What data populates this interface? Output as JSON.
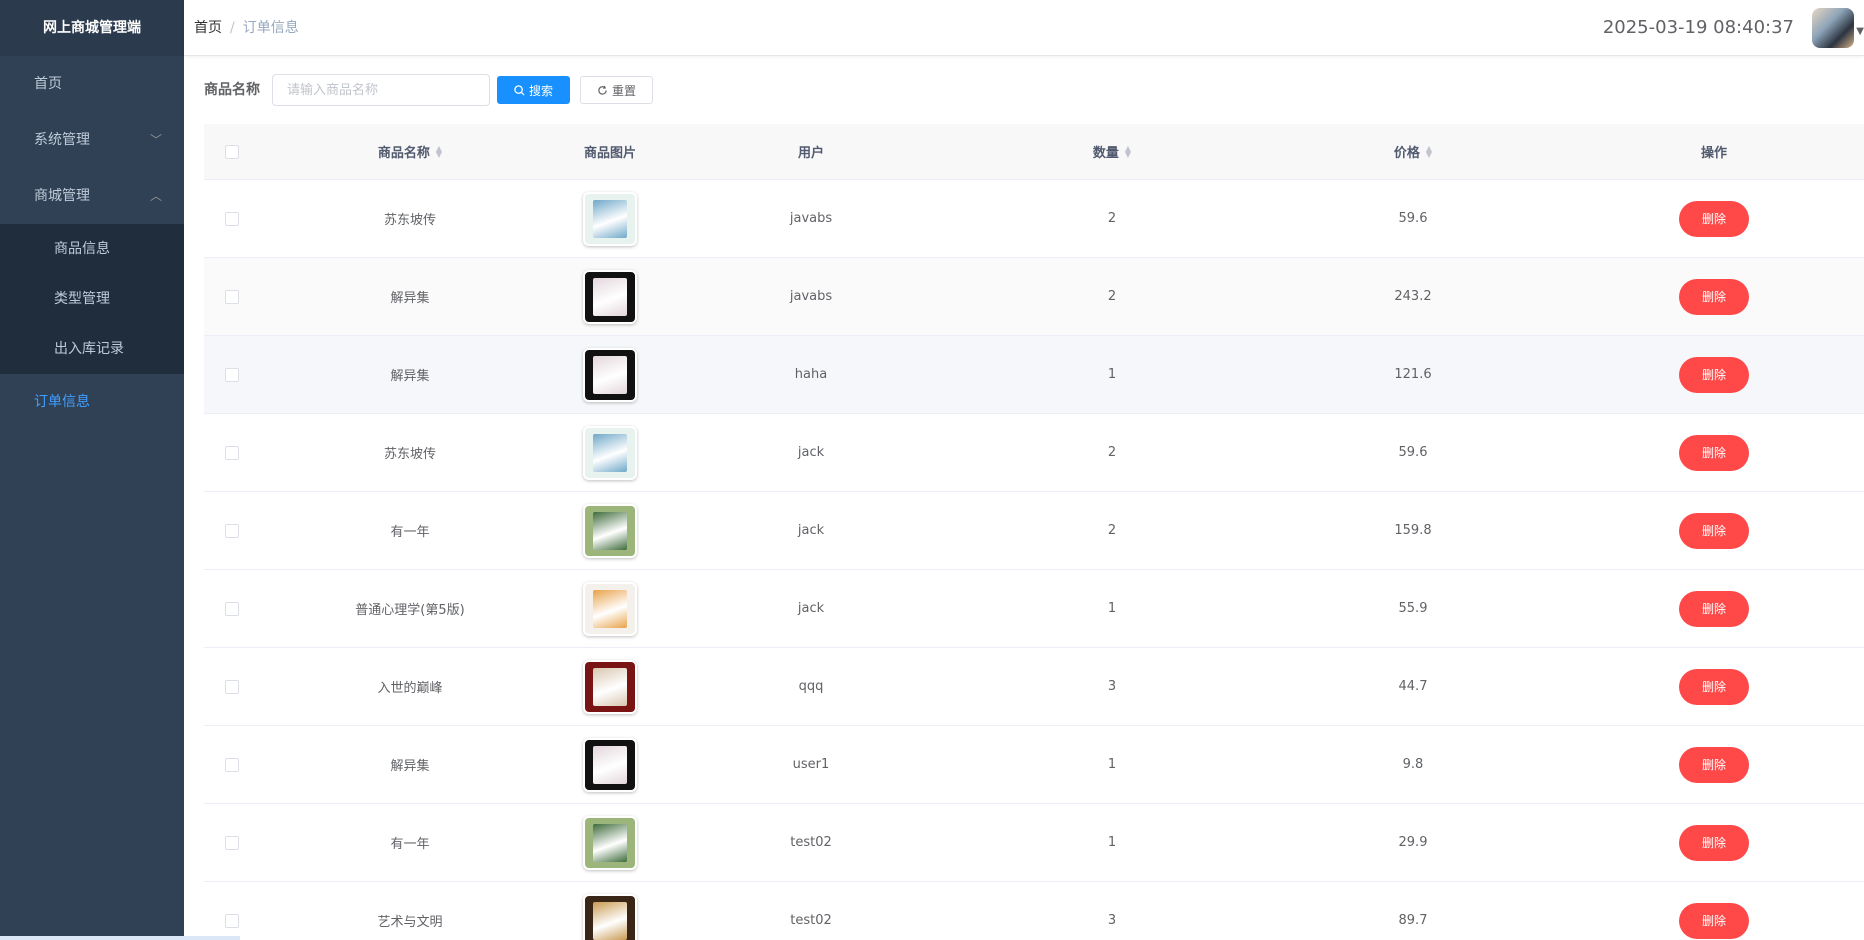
{
  "sidebar": {
    "logo": "网上商城管理端",
    "items": [
      {
        "label": "首页"
      },
      {
        "label": "系统管理",
        "arrow": "﹀"
      },
      {
        "label": "商城管理",
        "arrow": "︿"
      }
    ],
    "submenu": [
      {
        "label": "商品信息"
      },
      {
        "label": "类型管理"
      },
      {
        "label": "出入库记录"
      }
    ],
    "active": {
      "label": "订单信息"
    }
  },
  "header": {
    "breadcrumb_home": "首页",
    "breadcrumb_sep": "/",
    "breadcrumb_current": "订单信息",
    "datetime": "2025-03-19 08:40:37"
  },
  "search": {
    "label": "商品名称",
    "placeholder": "请输入商品名称",
    "search_button": "搜索",
    "reset_button": "重置"
  },
  "table": {
    "columns": [
      "商品名称",
      "商品图片",
      "用户",
      "数量",
      "价格",
      "操作"
    ],
    "delete_label": "删除",
    "rows": [
      {
        "name": "苏东坡传",
        "user": "javabs",
        "qty": "2",
        "price": "59.6",
        "cover": [
          "#e8f2ee",
          "#6fa8c9"
        ]
      },
      {
        "name": "解异集",
        "user": "javabs",
        "qty": "2",
        "price": "243.2",
        "cover": [
          "#111111",
          "#e3d6dc"
        ]
      },
      {
        "name": "解异集",
        "user": "haha",
        "qty": "1",
        "price": "121.6",
        "cover": [
          "#111111",
          "#e3d6dc"
        ]
      },
      {
        "name": "苏东坡传",
        "user": "jack",
        "qty": "2",
        "price": "59.6",
        "cover": [
          "#e8f2ee",
          "#6fa8c9"
        ]
      },
      {
        "name": "有一年",
        "user": "jack",
        "qty": "2",
        "price": "159.8",
        "cover": [
          "#9bb57a",
          "#3d6b3a"
        ]
      },
      {
        "name": "普通心理学(第5版)",
        "user": "jack",
        "qty": "1",
        "price": "55.9",
        "cover": [
          "#f4f1ec",
          "#e8a24a"
        ]
      },
      {
        "name": "入世的巅峰",
        "user": "qqq",
        "qty": "3",
        "price": "44.7",
        "cover": [
          "#7a1414",
          "#d8c7b0"
        ]
      },
      {
        "name": "解异集",
        "user": "user1",
        "qty": "1",
        "price": "9.8",
        "cover": [
          "#111111",
          "#e3d6dc"
        ]
      },
      {
        "name": "有一年",
        "user": "test02",
        "qty": "1",
        "price": "29.9",
        "cover": [
          "#9bb57a",
          "#3d6b3a"
        ]
      },
      {
        "name": "艺术与文明",
        "user": "test02",
        "qty": "3",
        "price": "89.7",
        "cover": [
          "#3a2616",
          "#c99a52"
        ]
      }
    ]
  }
}
